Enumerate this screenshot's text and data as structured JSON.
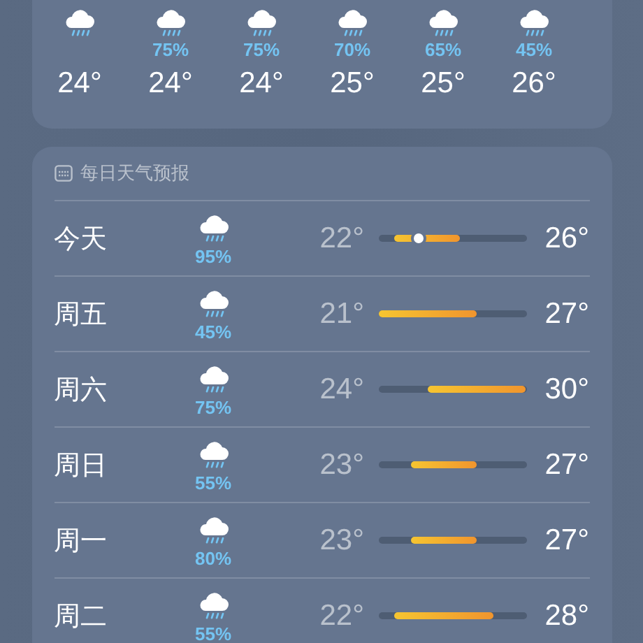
{
  "hourly": [
    {
      "temp": "24°"
    },
    {
      "chance": "75%",
      "temp": "24°"
    },
    {
      "chance": "75%",
      "temp": "24°"
    },
    {
      "chance": "70%",
      "temp": "25°"
    },
    {
      "chance": "65%",
      "temp": "25°"
    },
    {
      "chance": "45%",
      "temp": "26°"
    }
  ],
  "daily": {
    "title": "每日天气预报",
    "days": [
      {
        "day": "今天",
        "chance": "95%",
        "low": "22°",
        "high": "26°",
        "now": {
          "level": 0.27
        }
      },
      {
        "day": "周五",
        "chance": "45%",
        "low": "21°",
        "high": "27°"
      },
      {
        "day": "周六",
        "chance": "75%",
        "low": "24°",
        "high": "30°"
      },
      {
        "day": "周日",
        "chance": "55%",
        "low": "23°",
        "high": "27°"
      },
      {
        "day": "周一",
        "chance": "80%",
        "low": "23°",
        "high": "27°"
      },
      {
        "day": "周二",
        "chance": "55%",
        "low": "22°",
        "high": "28°"
      }
    ]
  }
}
